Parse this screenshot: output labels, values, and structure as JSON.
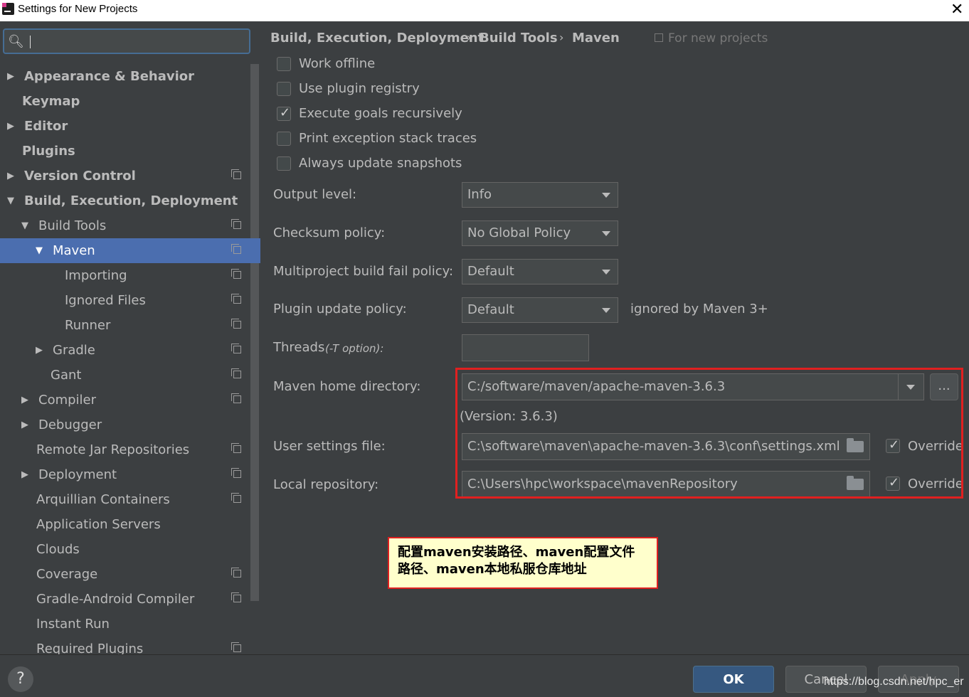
{
  "window": {
    "title": "Settings for New Projects",
    "close_glyph": "✕"
  },
  "sidebar": {
    "items": [
      {
        "label": "Appearance & Behavior",
        "arrow": "▶",
        "bold": true
      },
      {
        "label": "Keymap",
        "arrow": "",
        "bold": true
      },
      {
        "label": "Editor",
        "arrow": "▶",
        "bold": true
      },
      {
        "label": "Plugins",
        "arrow": "",
        "bold": true
      },
      {
        "label": "Version Control",
        "arrow": "▶",
        "bold": true
      },
      {
        "label": "Build, Execution, Deployment",
        "arrow": "▼",
        "bold": true
      },
      {
        "label": "Build Tools",
        "arrow": "▼"
      },
      {
        "label": "Maven",
        "arrow": "▼",
        "selected": true
      },
      {
        "label": "Importing",
        "arrow": ""
      },
      {
        "label": "Ignored Files",
        "arrow": ""
      },
      {
        "label": "Runner",
        "arrow": ""
      },
      {
        "label": "Gradle",
        "arrow": "▶"
      },
      {
        "label": "Gant",
        "arrow": ""
      },
      {
        "label": "Compiler",
        "arrow": "▶"
      },
      {
        "label": "Debugger",
        "arrow": "▶"
      },
      {
        "label": "Remote Jar Repositories",
        "arrow": ""
      },
      {
        "label": "Deployment",
        "arrow": "▶"
      },
      {
        "label": "Arquillian Containers",
        "arrow": ""
      },
      {
        "label": "Application Servers",
        "arrow": ""
      },
      {
        "label": "Clouds",
        "arrow": ""
      },
      {
        "label": "Coverage",
        "arrow": ""
      },
      {
        "label": "Gradle-Android Compiler",
        "arrow": ""
      },
      {
        "label": "Instant Run",
        "arrow": ""
      },
      {
        "label": "Required Plugins",
        "arrow": ""
      }
    ]
  },
  "breadcrumb": [
    "Build, Execution, Deployment",
    "Build Tools",
    "Maven"
  ],
  "breadcrumb_sep": "›",
  "for_new_projects": "For new projects",
  "checkboxes": [
    {
      "label": "Work offline",
      "checked": false
    },
    {
      "label": "Use plugin registry",
      "checked": false
    },
    {
      "label": "Execute goals recursively",
      "checked": true
    },
    {
      "label": "Print exception stack traces",
      "checked": false
    },
    {
      "label": "Always update snapshots",
      "checked": false
    }
  ],
  "form": {
    "output_level_label": "Output level:",
    "output_level_value": "Info",
    "checksum_label": "Checksum policy:",
    "checksum_value": "No Global Policy",
    "multiproject_label": "Multiproject build fail policy:",
    "multiproject_value": "Default",
    "plugin_update_label": "Plugin update policy:",
    "plugin_update_value": "Default",
    "plugin_update_note": "ignored by Maven 3+",
    "threads_label": "Threads",
    "threads_hint": "(-T option):",
    "threads_value": "",
    "maven_home_label": "Maven home directory:",
    "maven_home_value": "C:/software/maven/apache-maven-3.6.3",
    "browse_label": "...",
    "version_text": "(Version: 3.6.3)",
    "user_settings_label": "User settings file:",
    "user_settings_value": "C:\\software\\maven\\apache-maven-3.6.3\\conf\\settings.xml",
    "local_repo_label": "Local repository:",
    "local_repo_value": "C:\\Users\\hpc\\workspace\\mavenRepository",
    "override_label": "Override"
  },
  "annotation": {
    "line1": "配置maven安装路径、maven配置文件",
    "line2": "路径、maven本地私服仓库地址"
  },
  "buttons": {
    "help": "?",
    "ok": "OK",
    "cancel": "Cancel",
    "apply": "Apply"
  },
  "watermark": "https://blog.csdn.net/hpc_er"
}
